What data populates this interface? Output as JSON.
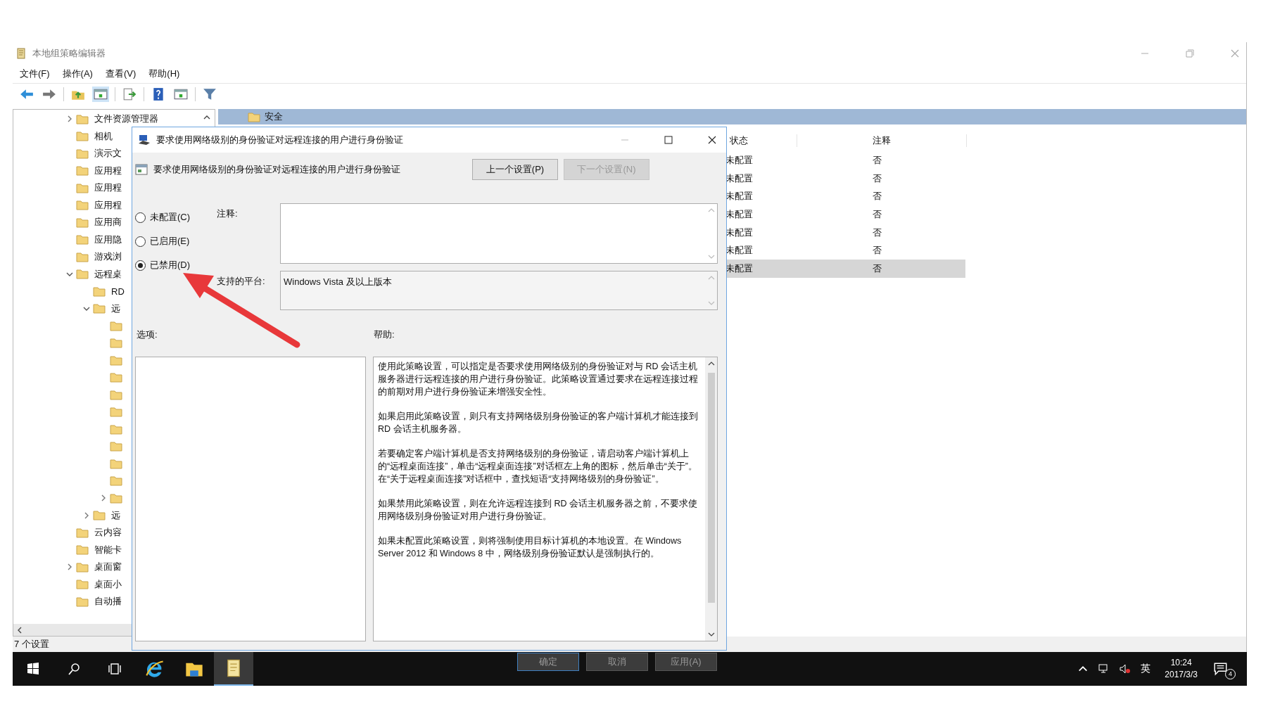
{
  "window": {
    "title": "本地组策略编辑器",
    "menu": [
      "文件(F)",
      "操作(A)",
      "查看(V)",
      "帮助(H)"
    ]
  },
  "tree": {
    "items": [
      {
        "label": "文件资源管理器",
        "expandable": true,
        "expanded": false
      },
      {
        "label": "相机",
        "expandable": false
      },
      {
        "label": "演示文",
        "expandable": false
      },
      {
        "label": "应用程",
        "expandable": false
      },
      {
        "label": "应用程",
        "expandable": false
      },
      {
        "label": "应用程",
        "expandable": false
      },
      {
        "label": "应用商",
        "expandable": false
      },
      {
        "label": "应用隐",
        "expandable": false
      },
      {
        "label": "游戏浏",
        "expandable": false
      },
      {
        "label": "远程桌",
        "expandable": true,
        "expanded": true,
        "children": [
          {
            "label": "RD",
            "expandable": false
          },
          {
            "label": "远",
            "expandable": true,
            "expanded": true,
            "children": [
              {
                "expandable": false
              },
              {
                "expandable": false
              },
              {
                "expandable": false
              },
              {
                "expandable": false
              },
              {
                "expandable": false
              },
              {
                "expandable": false
              },
              {
                "expandable": false
              },
              {
                "expandable": false
              },
              {
                "expandable": false
              },
              {
                "expandable": false
              },
              {
                "expandable": true,
                "expanded": false
              }
            ]
          },
          {
            "label": "远",
            "expandable": true,
            "expanded": false
          }
        ]
      },
      {
        "label": "云内容",
        "expandable": false
      },
      {
        "label": "智能卡",
        "expandable": false
      },
      {
        "label": "桌面窗",
        "expandable": true,
        "expanded": false
      },
      {
        "label": "桌面小",
        "expandable": false
      },
      {
        "label": "自动播",
        "expandable": false
      }
    ]
  },
  "content": {
    "folder": "安全",
    "columns": [
      "状态",
      "注释"
    ],
    "rows": [
      {
        "status": "未配置",
        "comment": "否",
        "selected": false
      },
      {
        "status": "未配置",
        "comment": "否",
        "selected": false
      },
      {
        "status": "未配置",
        "comment": "否",
        "selected": false
      },
      {
        "status": "未配置",
        "comment": "否",
        "selected": false
      },
      {
        "status": "未配置",
        "comment": "否",
        "selected": false
      },
      {
        "status": "未配置",
        "comment": "否",
        "selected": false
      },
      {
        "status": "未配置",
        "comment": "否",
        "selected": true
      }
    ]
  },
  "status_bar": "7 个设置",
  "dialog": {
    "title": "要求使用网络级别的身份验证对远程连接的用户进行身份验证",
    "setting_name": "要求使用网络级别的身份验证对远程连接的用户进行身份验证",
    "prev_button": {
      "label": "上一个设置(P)",
      "disabled": false
    },
    "next_button": {
      "label": "下一个设置(N)",
      "disabled": true
    },
    "options": [
      {
        "label": "未配置(C)",
        "selected": false
      },
      {
        "label": "已启用(E)",
        "selected": false
      },
      {
        "label": "已禁用(D)",
        "selected": true
      }
    ],
    "comment_label": "注释:",
    "platform_label": "支持的平台:",
    "platform": "Windows Vista 及以上版本",
    "options_label": "选项:",
    "help_label": "帮助:",
    "help": [
      "使用此策略设置，可以指定是否要求使用网络级别的身份验证对与 RD 会话主机服务器进行远程连接的用户进行身份验证。此策略设置通过要求在远程连接过程的前期对用户进行身份验证来增强安全性。",
      "如果启用此策略设置，则只有支持网络级别身份验证的客户端计算机才能连接到 RD 会话主机服务器。",
      "若要确定客户端计算机是否支持网络级别的身份验证，请启动客户端计算机上的“远程桌面连接”，单击“远程桌面连接”对话框左上角的图标，然后单击“关于”。在“关于远程桌面连接”对话框中，查找短语“支持网络级别的身份验证”。",
      "如果禁用此策略设置，则在允许远程连接到 RD 会话主机服务器之前，不要求使用网络级别身份验证对用户进行身份验证。",
      "如果未配置此策略设置，则将强制使用目标计算机的本地设置。在 Windows Server 2012 和 Windows 8 中，网络级别身份验证默认是强制执行的。"
    ],
    "buttons": [
      "确定",
      "取消",
      "应用(A)"
    ]
  },
  "taskbar": {
    "apps": [
      {
        "kind": "browser",
        "selected": false
      },
      {
        "kind": "files",
        "selected": false
      },
      {
        "kind": "editor",
        "selected": true
      }
    ],
    "ime": "英",
    "time": "10:24",
    "date": "2017/3/3",
    "notifications": "4"
  }
}
